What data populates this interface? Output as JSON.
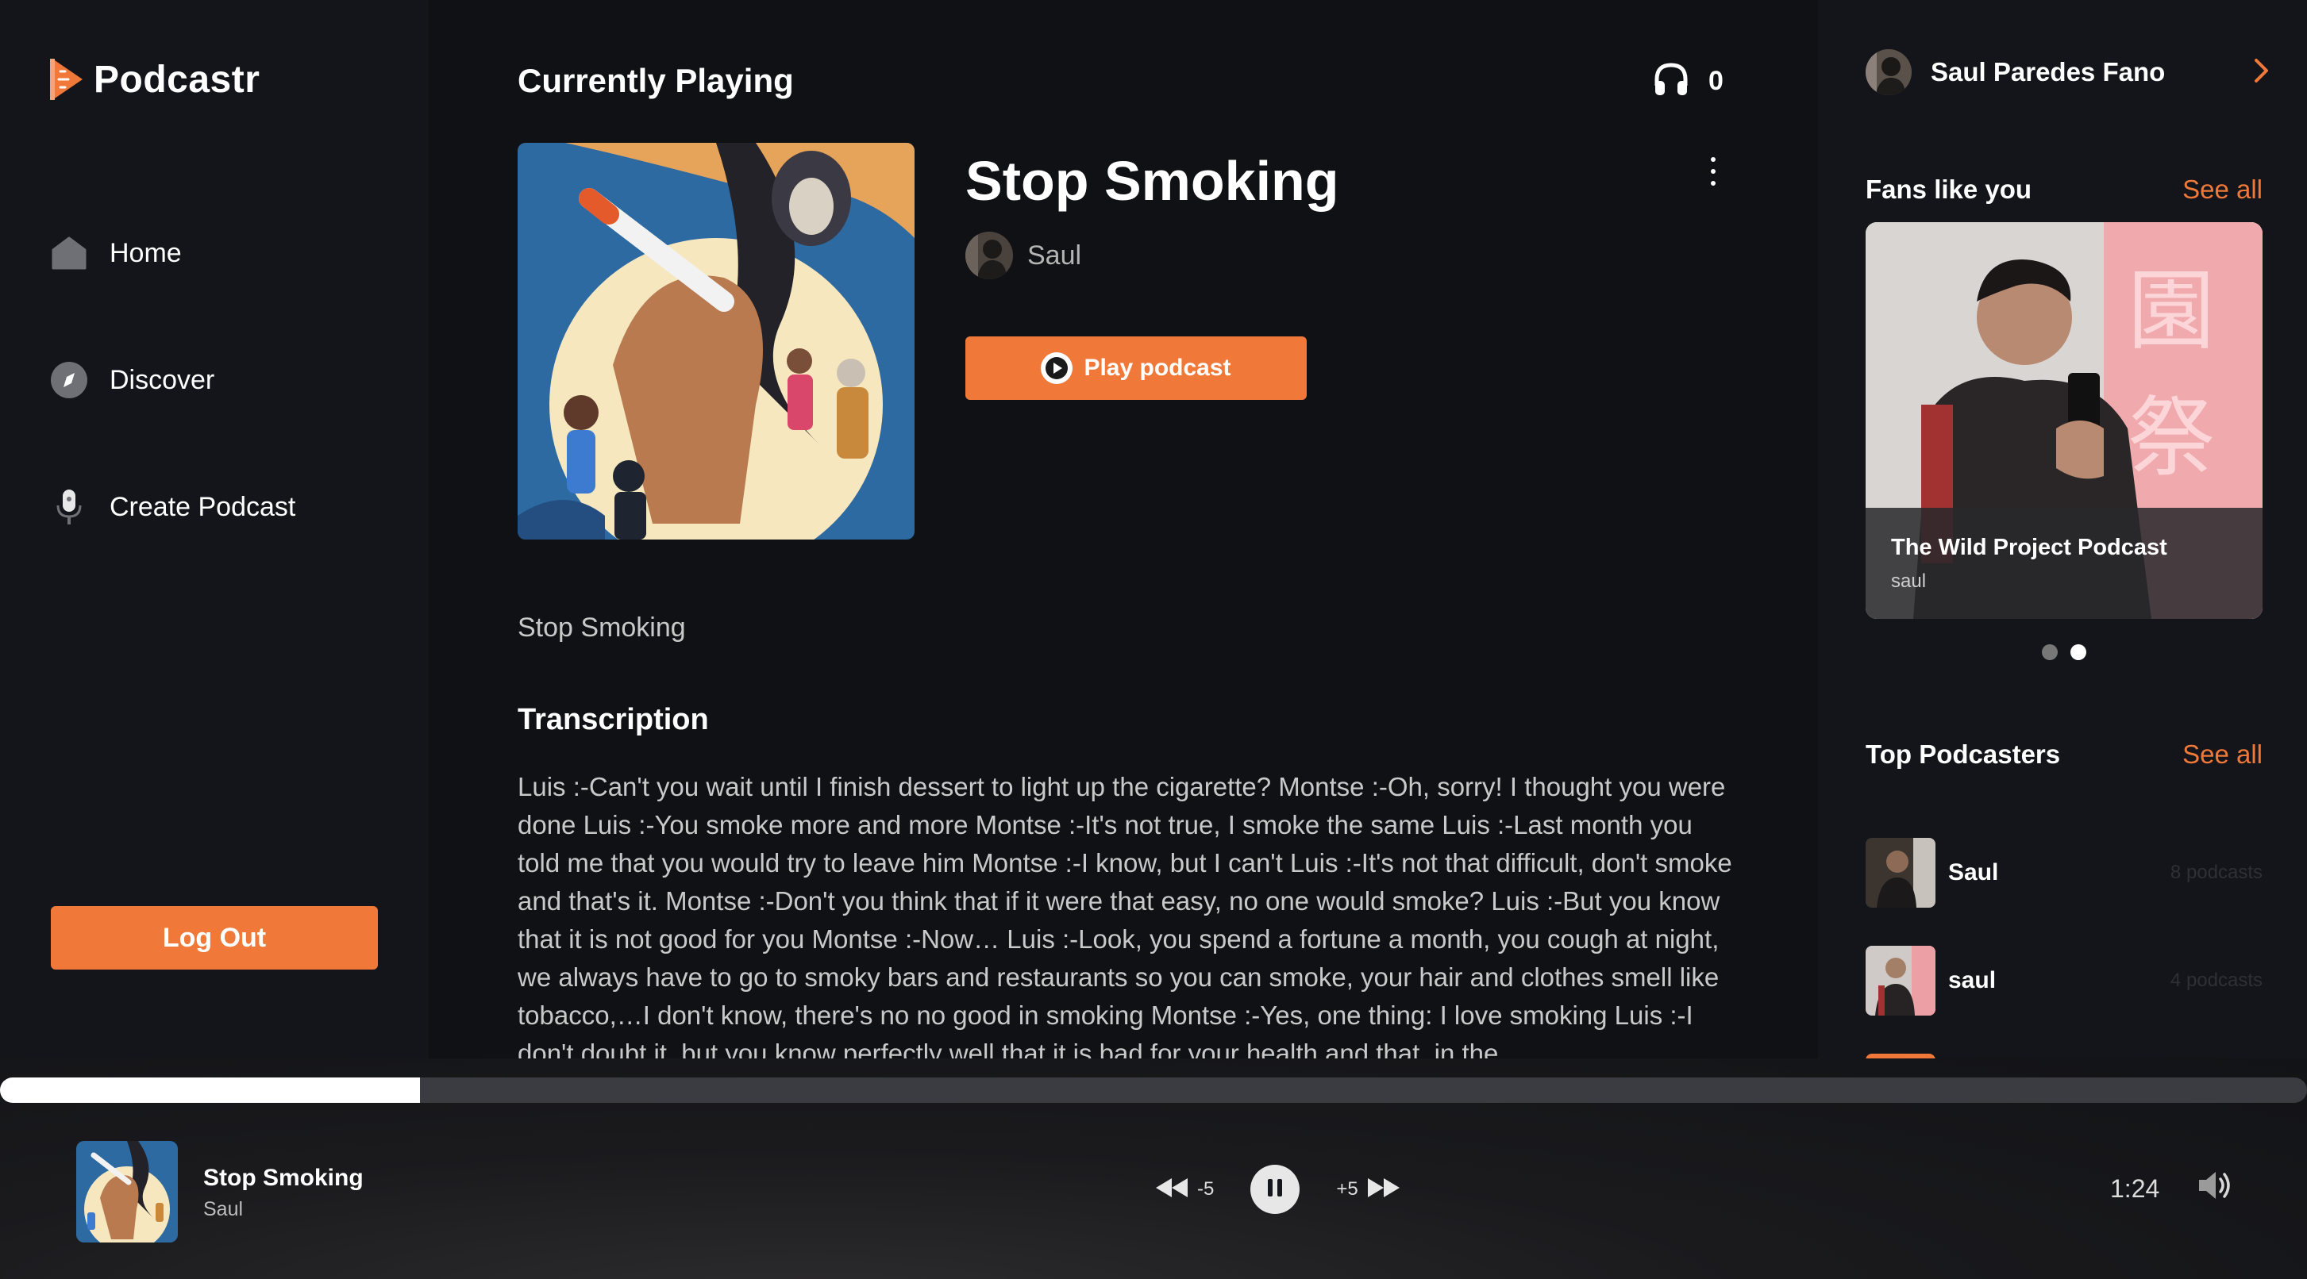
{
  "app": {
    "name": "Podcastr",
    "brand_color": "#f0793a"
  },
  "sidebar": {
    "items": [
      {
        "label": "Home",
        "icon": "home-icon"
      },
      {
        "label": "Discover",
        "icon": "compass-icon"
      },
      {
        "label": "Create Podcast",
        "icon": "microphone-icon"
      }
    ],
    "logout_label": "Log Out"
  },
  "main": {
    "section_title": "Currently Playing",
    "listen_count": "0",
    "podcast_title": "Stop Smoking",
    "author": "Saul",
    "play_label": "Play podcast",
    "description": "Stop Smoking",
    "transcription_title": "Transcription",
    "transcription": "Luis :-Can't you wait until I finish dessert to light up the cigarette? Montse :-Oh, sorry! I thought you were done Luis :-You smoke more and more Montse :-It's not true, I smoke the same Luis :-Last month you told me that you would try to leave him Montse :-I know, but I can't Luis :-It's not that difficult, don't smoke and that's it. Montse :-Don't you think that if it were that easy, no one would smoke? Luis :-But you know that it is not good for you Montse :-Now… Luis :-Look, you spend a fortune a month, you cough at night, we always have to go to smoky bars and restaurants so you can smoke, your hair and clothes smell like tobacco,…I don't know, there's no no good in smoking Montse :-Yes, one thing: I love smoking Luis :-I don't doubt it, but you know perfectly well that it is bad for your health and that, in the"
  },
  "rightbar": {
    "user_name": "Saul Paredes Fano",
    "fans_title": "Fans like you",
    "fans_see_all": "See all",
    "fan_card": {
      "title": "The Wild Project Podcast",
      "subtitle": "saul"
    },
    "carousel_active_index": 1,
    "top_title": "Top Podcasters",
    "top_see_all": "See all",
    "podcasters": [
      {
        "name": "Saul",
        "count": "8 podcasts"
      },
      {
        "name": "saul",
        "count": "4 podcasts"
      }
    ]
  },
  "player": {
    "progress_fraction": 0.182,
    "title": "Stop Smoking",
    "author": "Saul",
    "rewind_label": "-5",
    "forward_label": "+5",
    "time": "1:24"
  }
}
